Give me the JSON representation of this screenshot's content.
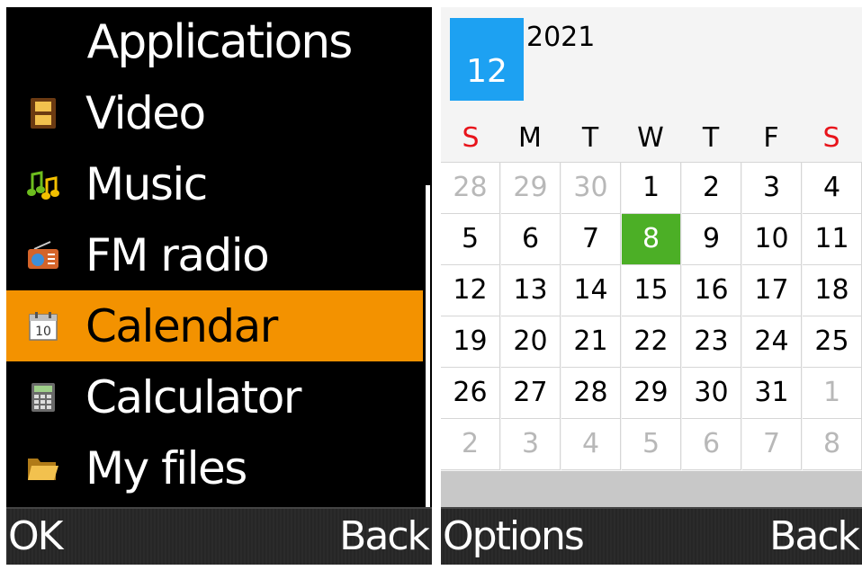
{
  "left_screen": {
    "title": "Applications",
    "menu": [
      {
        "label": "Video",
        "icon": "video-film-icon",
        "selected": false
      },
      {
        "label": "Music",
        "icon": "music-note-icon",
        "selected": false
      },
      {
        "label": "FM radio",
        "icon": "radio-icon",
        "selected": false
      },
      {
        "label": "Calendar",
        "icon": "calendar-icon",
        "selected": true
      },
      {
        "label": "Calculator",
        "icon": "calculator-icon",
        "selected": false
      },
      {
        "label": "My files",
        "icon": "folder-icon",
        "selected": false
      }
    ],
    "softkeys": {
      "left": "OK",
      "right": "Back"
    },
    "colors": {
      "background": "#000000",
      "highlight": "#f39200"
    }
  },
  "right_screen": {
    "month": "12",
    "year": "2021",
    "weekdays": [
      "S",
      "M",
      "T",
      "W",
      "T",
      "F",
      "S"
    ],
    "weeks": [
      [
        "28",
        "29",
        "30",
        "1",
        "2",
        "3",
        "4"
      ],
      [
        "5",
        "6",
        "7",
        "8",
        "9",
        "10",
        "11"
      ],
      [
        "12",
        "13",
        "14",
        "15",
        "16",
        "17",
        "18"
      ],
      [
        "19",
        "20",
        "21",
        "22",
        "23",
        "24",
        "25"
      ],
      [
        "26",
        "27",
        "28",
        "29",
        "30",
        "31",
        "1"
      ],
      [
        "2",
        "3",
        "4",
        "5",
        "6",
        "7",
        "8"
      ]
    ],
    "selected_day": "8",
    "softkeys": {
      "left": "Options",
      "right": "Back"
    },
    "colors": {
      "month_badge": "#1da1f2",
      "selected_day": "#4caf26",
      "weekend": "#e8141b"
    }
  }
}
